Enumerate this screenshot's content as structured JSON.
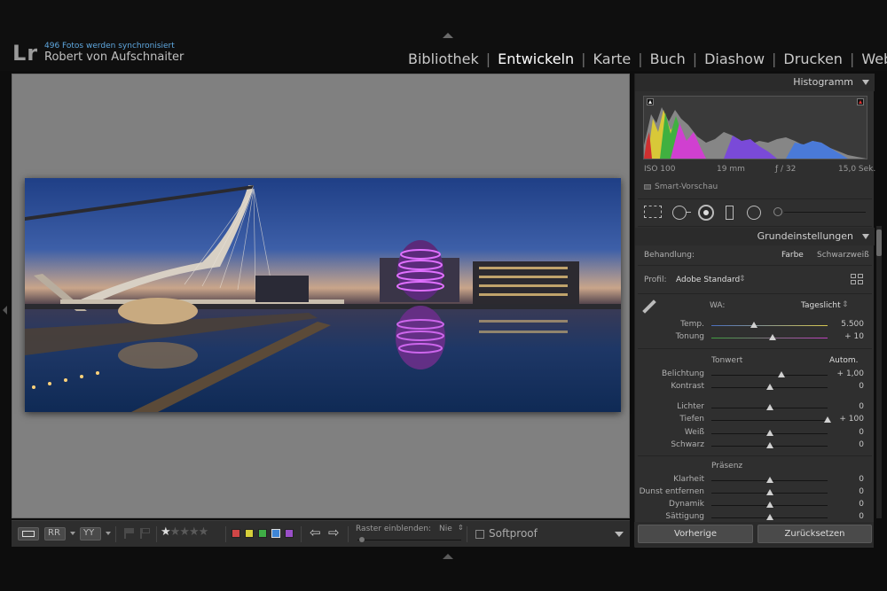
{
  "identity": {
    "logo": "Lr",
    "sync_status": "496 Fotos werden synchronisiert",
    "user": "Robert von Aufschnaiter"
  },
  "modules": [
    "Bibliothek",
    "Entwickeln",
    "Karte",
    "Buch",
    "Diashow",
    "Drucken",
    "Web"
  ],
  "active_module": "Entwickeln",
  "toolbar": {
    "grid_overlay_label": "Raster einblenden:",
    "grid_overlay_value": "Nie",
    "softproof_label": "Softproof",
    "softproof_checked": false,
    "color_labels": [
      "#d04646",
      "#d6cf3a",
      "#3fae46",
      "#3f86d6",
      "#9a4fc8"
    ],
    "rating_stars": 5,
    "rating_value": 0
  },
  "histogram": {
    "title": "Histogramm",
    "iso": "ISO 100",
    "focal": "19 mm",
    "aperture": "ƒ / 32",
    "shutter": "15,0 Sek.",
    "smart_preview": "Smart-Vorschau"
  },
  "basic": {
    "title": "Grundeinstellungen",
    "treatment_label": "Behandlung:",
    "treatment_color": "Farbe",
    "treatment_bw": "Schwarzweiß",
    "profile_label": "Profil:",
    "profile_value": "Adobe Standard",
    "wb_label": "WA:",
    "wb_value": "Tageslicht",
    "tone_label": "Tonwert",
    "auto_label": "Autom.",
    "presence_label": "Präsenz"
  },
  "sliders": [
    {
      "label": "Temp.",
      "value": "5.500",
      "position": 0.37
    },
    {
      "label": "Tonung",
      "value": "+ 10",
      "position": 0.53
    },
    {
      "label": "Belichtung",
      "value": "+ 1,00",
      "position": 0.6
    },
    {
      "label": "Kontrast",
      "value": "0",
      "position": 0.5
    },
    {
      "label": "Lichter",
      "value": "0",
      "position": 0.5
    },
    {
      "label": "Tiefen",
      "value": "+ 100",
      "position": 1.0
    },
    {
      "label": "Weiß",
      "value": "0",
      "position": 0.5
    },
    {
      "label": "Schwarz",
      "value": "0",
      "position": 0.5
    },
    {
      "label": "Klarheit",
      "value": "0",
      "position": 0.5
    },
    {
      "label": "Dunst entfernen",
      "value": "0",
      "position": 0.5
    },
    {
      "label": "Dynamik",
      "value": "0",
      "position": 0.5
    },
    {
      "label": "Sättigung",
      "value": "0",
      "position": 0.5
    }
  ],
  "buttons": {
    "previous": "Vorherige",
    "reset": "Zurücksetzen"
  }
}
